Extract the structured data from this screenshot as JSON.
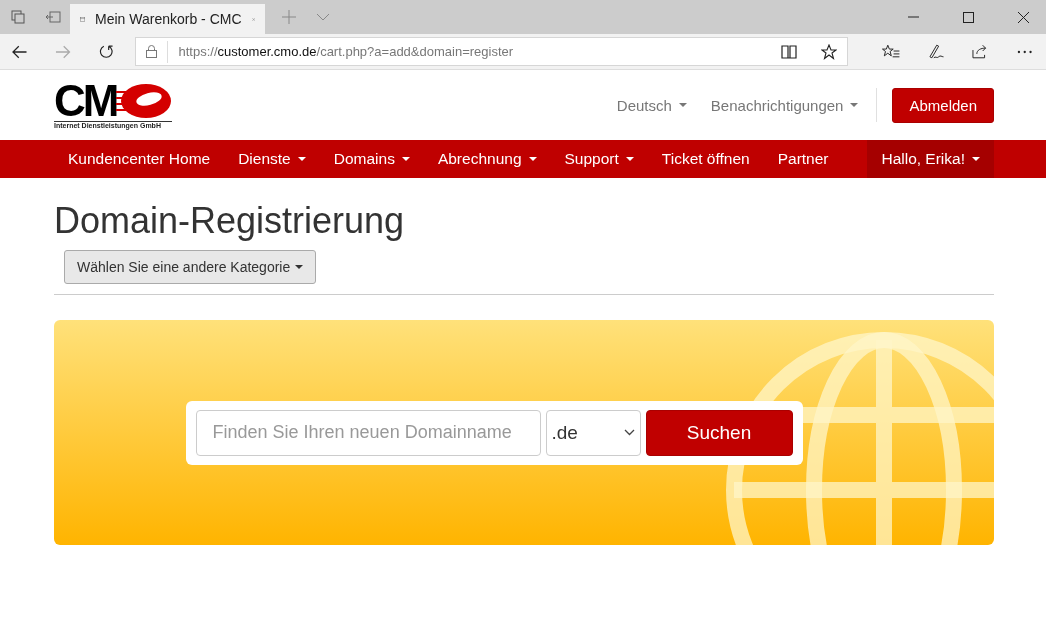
{
  "browser": {
    "tab_title": "Mein Warenkorb - CMC",
    "url_scheme": "https://",
    "url_host": "customer.cmo.de",
    "url_path": "/cart.php?a=add&domain=register"
  },
  "logo": {
    "letters": "CM",
    "tagline": "Internet Dienstleistungen GmbH"
  },
  "top_links": [
    {
      "label": "Deutsch",
      "dropdown": true
    },
    {
      "label": "Benachrichtigungen",
      "dropdown": true
    }
  ],
  "logout_button": "Abmelden",
  "nav": [
    {
      "label": "Kundencenter Home",
      "dropdown": false
    },
    {
      "label": "Dienste",
      "dropdown": true
    },
    {
      "label": "Domains",
      "dropdown": true
    },
    {
      "label": "Abrechnung",
      "dropdown": true
    },
    {
      "label": "Support",
      "dropdown": true
    },
    {
      "label": "Ticket öffnen",
      "dropdown": false
    },
    {
      "label": "Partner",
      "dropdown": false
    }
  ],
  "user_menu": {
    "label": "Hallo, Erika!",
    "dropdown": true
  },
  "page_title": "Domain-Registrierung",
  "category_button": "Wählen Sie eine andere Kategorie",
  "search": {
    "placeholder": "Finden Sie Ihren neuen Domainname",
    "tld": ".de",
    "button": "Suchen"
  }
}
